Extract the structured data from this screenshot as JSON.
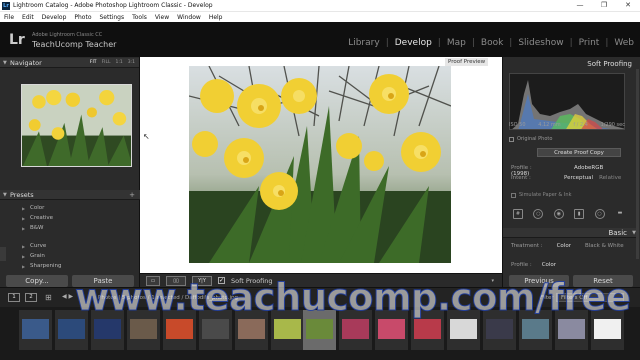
{
  "window": {
    "title": "Lightroom Catalog - Adobe Photoshop Lightroom Classic - Develop",
    "app_icon_letters": "Lr",
    "controls": {
      "minimize": "—",
      "maximize": "❐",
      "close": "✕"
    }
  },
  "menu": [
    "File",
    "Edit",
    "Develop",
    "Photo",
    "Settings",
    "Tools",
    "View",
    "Window",
    "Help"
  ],
  "identity": {
    "logo": "Lr",
    "line1": "Adobe Lightroom Classic CC",
    "line2": "TeachUcomp Teacher"
  },
  "modules": {
    "items": [
      "Library",
      "Develop",
      "Map",
      "Book",
      "Slideshow",
      "Print",
      "Web"
    ],
    "active": "Develop",
    "separator": "|"
  },
  "left_panel": {
    "navigator": {
      "title": "Navigator",
      "options": [
        "FIT",
        "FILL",
        "1:1",
        "3:1"
      ],
      "active_option": "FIT"
    },
    "presets": {
      "title": "Presets",
      "add_symbol": "+",
      "items": [
        "Color",
        "Creative",
        "B&W",
        "Curve",
        "Grain",
        "Sharpening"
      ]
    },
    "copy_label": "Copy...",
    "paste_label": "Paste"
  },
  "center": {
    "proof_preview_label": "Proof Preview"
  },
  "toolbar": {
    "view_btn": "▭",
    "compare_btn": "▯▯",
    "yy_btn": "Y|Y",
    "soft_proofing_checked": true,
    "check_mark": "✓",
    "soft_proofing_label": "Soft Proofing",
    "dropdown_symbol": "▾"
  },
  "right_panel": {
    "title": "Soft Proofing",
    "histogram_info": [
      "ISO 50",
      "4.12 mm",
      "f / 2.4",
      "1/290 sec"
    ],
    "original_photo_label": "Original Photo",
    "create_proof_copy": "Create Proof Copy",
    "profile_label": "Profile :",
    "profile_value": "AdobeRGB (1998)",
    "intent_label": "Intent :",
    "intent_options": [
      "Perceptual",
      "Relative"
    ],
    "intent_active": "Perceptual",
    "simulate_label": "Simulate Paper & Ink",
    "basic_title": "Basic",
    "treatment_label": "Treatment :",
    "treatment_options": [
      "Color",
      "Black & White"
    ],
    "treatment_active": "Color",
    "profile2_label": "Profile :",
    "profile2_value": "Color",
    "previous_label": "Previous",
    "reset_label": "Reset"
  },
  "filmstrip": {
    "screen1": "1",
    "screen2": "2",
    "grid_symbol": "⊞",
    "nav_arrows": "◀ ▶",
    "path_text": "Photos  |  5 photos / 1 selected / Daffodils_photo.jpg",
    "filter_label": "Filter :",
    "filter_value": "Filters Off"
  },
  "watermark": "www.teachucomp.com/free",
  "colors": {
    "accent": "#e6e6e6",
    "panel_bg": "#2b2b2b",
    "daffodil_yellow": "#f2d23a"
  }
}
